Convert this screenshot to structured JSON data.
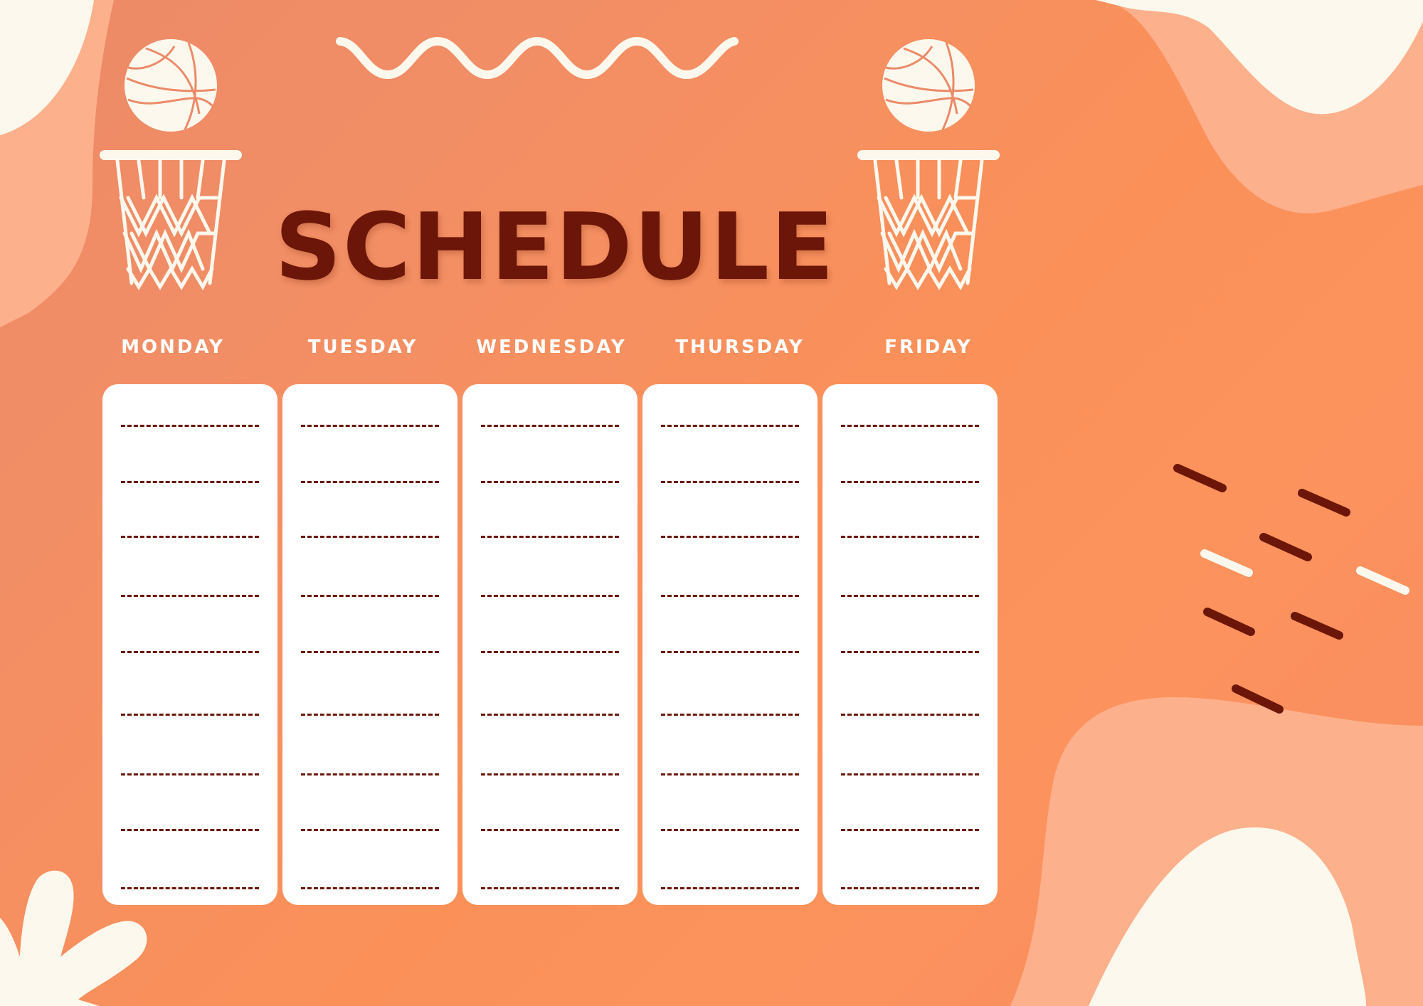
{
  "title": "SCHEDULE",
  "colors": {
    "background_start": "#ec8a68",
    "background_end": "#fc925d",
    "title": "#6b1608",
    "accent_light": "#fdb08c",
    "cream": "#fdf8ee",
    "card": "#ffffff",
    "dash": "#6b1608"
  },
  "days": [
    {
      "label": "MONDAY"
    },
    {
      "label": "TUESDAY"
    },
    {
      "label": "WEDNESDAY"
    },
    {
      "label": "THURSDAY"
    },
    {
      "label": "FRIDAY"
    }
  ],
  "lines_per_day": 9,
  "decorations": [
    "basketball-icon",
    "basketball-hoop-icon",
    "wave-squiggle",
    "dash-confetti",
    "flower-shape",
    "blob-shapes"
  ]
}
